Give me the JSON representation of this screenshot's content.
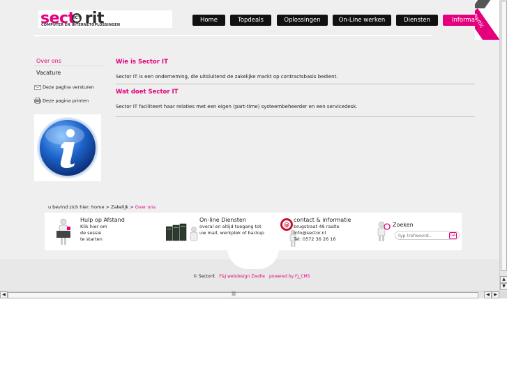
{
  "logo": {
    "word_a": "sect",
    "ring": "ICT",
    "word_b": "rit",
    "tagline": "COMPUTER EN INTERNETOPLOSSINGEN"
  },
  "nav": [
    {
      "label": "Home",
      "active": false
    },
    {
      "label": "Topdeals",
      "active": false
    },
    {
      "label": "Oplossingen",
      "active": false
    },
    {
      "label": "On-Line werken",
      "active": false
    },
    {
      "label": "Diensten",
      "active": false
    },
    {
      "label": "Informatie",
      "active": true
    }
  ],
  "ribbon": {
    "label": "Partic"
  },
  "subnav": [
    {
      "label": "Over ons",
      "active": true
    },
    {
      "label": "Vacature",
      "active": false
    }
  ],
  "tools": {
    "send": "Deze pagina versturen",
    "print": "Deze pagina printen"
  },
  "content": {
    "sections": [
      {
        "heading": "Wie is Sector IT",
        "text": "Sector IT is een onderneming, die uitsluitend de zakelijke markt op contractsbasis bedient."
      },
      {
        "heading": "Wat doet Sector IT",
        "text": "Sector IT faciliteert haar relaties met een eigen (part-time) systeembeheerder en een servicedesk."
      }
    ]
  },
  "breadcrumb": {
    "prefix": "u bevind zich hier:",
    "trail": "home > Zakelijk >",
    "current": "Over ons"
  },
  "footer": {
    "help": {
      "title": "Hulp op Afstand",
      "lines": [
        "Klik hier om",
        "de sessie",
        "te starten"
      ]
    },
    "online": {
      "title": "On-line Diensten",
      "lines": [
        "overal en altijd toegang tot",
        "uw mail, werkplek of backup"
      ]
    },
    "contact": {
      "title": "contact & informatie",
      "lines": [
        "brugstraat 49 raalte",
        "info@sector.nl",
        "Tel: 0572 36 26 16"
      ]
    },
    "search": {
      "title": "Zoeken",
      "placeholder": "typ trefwoord..",
      "go": "GA"
    }
  },
  "credits": {
    "copyright": "© Sectorit",
    "design": "F&J webdesign Zwolle",
    "powered": "powered by FJ_CMS"
  },
  "colors": {
    "accent": "#e4007c",
    "nav_bg": "#111111",
    "page_bg": "#efefef"
  }
}
